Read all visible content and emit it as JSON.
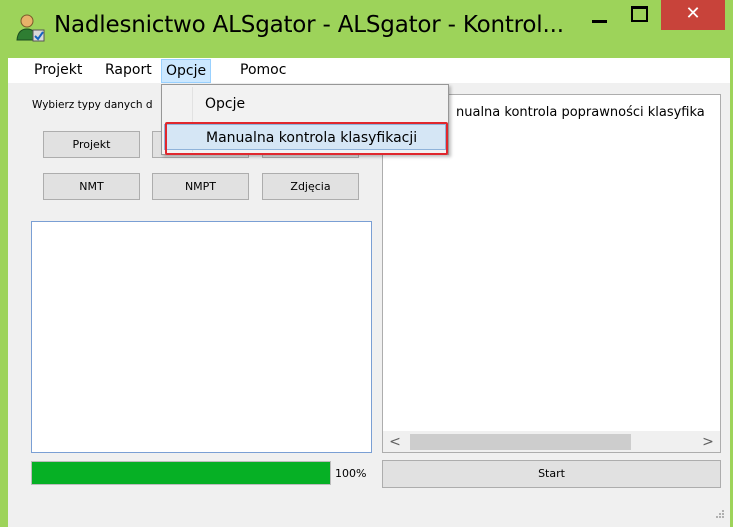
{
  "window": {
    "title": "Nadlesnictwo ALSgator - ALSgator - Kontrol...",
    "close_glyph": "✕",
    "accent_color": "#9dd35a"
  },
  "menubar": {
    "items": [
      "Projekt",
      "Raport",
      "Opcje",
      "Pomoc"
    ]
  },
  "opcje_menu": {
    "items": [
      "Opcje",
      "Manualna kontrola klasyfikacji"
    ],
    "highlighted_index": 1
  },
  "left_panel": {
    "prompt": "Wybierz typy danych d",
    "buttons_row1": [
      "Projekt",
      "",
      ""
    ],
    "buttons_row2": [
      "NMT",
      "NMPT",
      "Zdjęcia"
    ],
    "progress_value": 1.0,
    "progress_label": "100%",
    "progress_color": "#06b025"
  },
  "right_panel": {
    "log_text": "nualna kontrola poprawności klasyfika",
    "scroll_left_glyph": "<",
    "scroll_right_glyph": ">",
    "start_label": "Start"
  }
}
